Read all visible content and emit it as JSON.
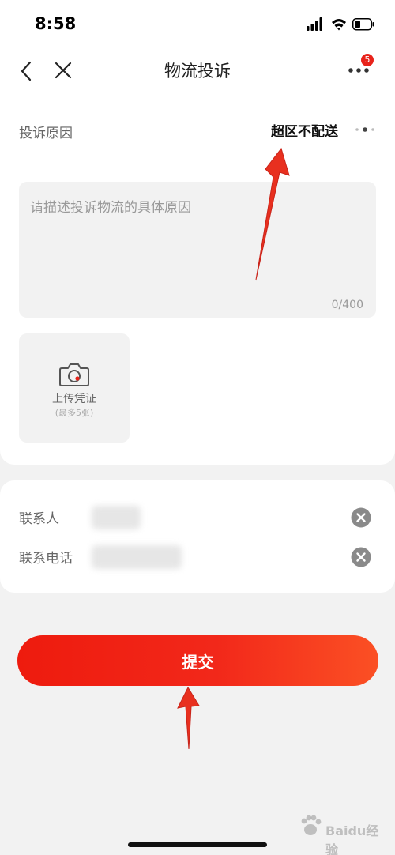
{
  "status_bar": {
    "time": "8:58"
  },
  "nav": {
    "title": "物流投诉",
    "badge_count": "5"
  },
  "complaint": {
    "reason_label": "投诉原因",
    "reason_value": "超区不配送",
    "description_placeholder": "请描述投诉物流的具体原因",
    "description_count": "0/400",
    "upload_label": "上传凭证",
    "upload_hint": "(最多5张)"
  },
  "contact": {
    "name_label": "联系人",
    "phone_label": "联系电话"
  },
  "submit": {
    "label": "提交"
  },
  "watermark": {
    "brand": "Baidu",
    "sub": "经验"
  },
  "colors": {
    "accent": "#ee1b0e",
    "accent_end": "#fb5024",
    "badge": "#e8231b",
    "annotation_arrow": "#e8301f"
  }
}
